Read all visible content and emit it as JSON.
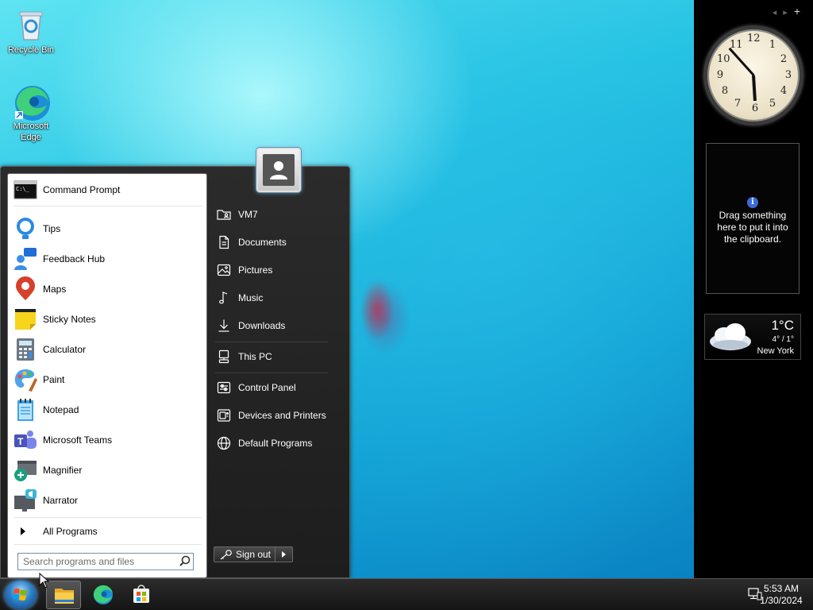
{
  "desktop": {
    "icons": [
      {
        "label": "Recycle Bin"
      },
      {
        "label": "Microsoft Edge"
      }
    ]
  },
  "gadgets": {
    "clock": {
      "numbers": [
        "12",
        "1",
        "2",
        "3",
        "4",
        "5",
        "6",
        "7",
        "8",
        "9",
        "10",
        "11"
      ],
      "time": "5:53"
    },
    "clipboard": {
      "message": "Drag something here to put it into the clipboard."
    },
    "weather": {
      "temperature": "1°C",
      "range": "4° / 1°",
      "city": "New York"
    }
  },
  "start_menu": {
    "programs": [
      {
        "label": "Command Prompt",
        "icon": "command-prompt-icon"
      },
      {
        "label": "Tips",
        "icon": "tips-icon"
      },
      {
        "label": "Feedback Hub",
        "icon": "feedback-hub-icon"
      },
      {
        "label": "Maps",
        "icon": "maps-icon"
      },
      {
        "label": "Sticky Notes",
        "icon": "sticky-notes-icon"
      },
      {
        "label": "Calculator",
        "icon": "calculator-icon"
      },
      {
        "label": "Paint",
        "icon": "paint-icon"
      },
      {
        "label": "Notepad",
        "icon": "notepad-icon"
      },
      {
        "label": "Microsoft Teams",
        "icon": "teams-icon"
      },
      {
        "label": "Magnifier",
        "icon": "magnifier-icon"
      },
      {
        "label": "Narrator",
        "icon": "narrator-icon"
      }
    ],
    "all_programs": "All Programs",
    "search_placeholder": "Search programs and files",
    "right": [
      {
        "label": "VM7"
      },
      {
        "label": "Documents"
      },
      {
        "label": "Pictures"
      },
      {
        "label": "Music"
      },
      {
        "label": "Downloads"
      },
      {
        "label": "This PC"
      },
      {
        "label": "Control Panel"
      },
      {
        "label": "Devices and Printers"
      },
      {
        "label": "Default Programs"
      }
    ],
    "sign_out": "Sign out"
  },
  "taskbar": {
    "time": "5:53 AM",
    "date": "1/30/2024"
  }
}
